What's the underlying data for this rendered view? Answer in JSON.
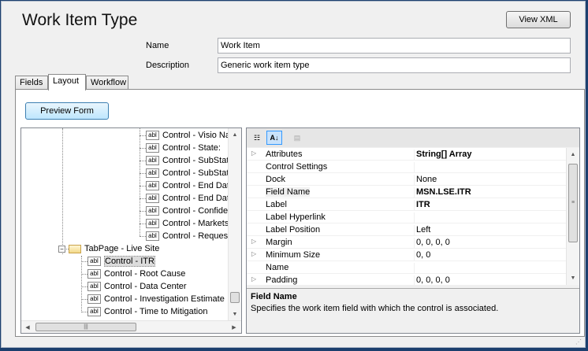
{
  "window": {
    "title": "Work Item Type",
    "view_xml": "View XML"
  },
  "form": {
    "name_label": "Name",
    "name_value": "Work Item",
    "desc_label": "Description",
    "desc_value": "Generic work item type"
  },
  "tabs": [
    {
      "label": "Fields"
    },
    {
      "label": "Layout"
    },
    {
      "label": "Workflow"
    }
  ],
  "preview_button": "Preview Form",
  "tree": {
    "items_top": [
      "Control - Visio Nar",
      "Control - State:",
      "Control - SubState",
      "Control - SubState",
      "Control - End Date",
      "Control - End Date",
      "Control - Confiden",
      "Control - Markets:",
      "Control - Requeste"
    ],
    "tabpage": "TabPage - Live Site",
    "items_bottom": [
      "Control - ITR",
      "Control - Root Cause",
      "Control - Data Center",
      "Control - Investigation Estimate",
      "Control - Time to Mitigation"
    ],
    "icon_text": "abl"
  },
  "properties": {
    "rows": [
      {
        "name": "Attributes",
        "value": "String[] Array",
        "expand": true,
        "bold": true
      },
      {
        "name": "Control Settings",
        "value": "",
        "expand": false,
        "bold": false
      },
      {
        "name": "Dock",
        "value": "None",
        "expand": false,
        "bold": false
      },
      {
        "name": "Field Name",
        "value": "MSN.LSE.ITR",
        "expand": false,
        "bold": true
      },
      {
        "name": "Label",
        "value": "ITR",
        "expand": false,
        "bold": true
      },
      {
        "name": "Label Hyperlink",
        "value": "",
        "expand": false,
        "bold": false
      },
      {
        "name": "Label Position",
        "value": "Left",
        "expand": false,
        "bold": false
      },
      {
        "name": "Margin",
        "value": "0, 0, 0, 0",
        "expand": true,
        "bold": false
      },
      {
        "name": "Minimum Size",
        "value": "0, 0",
        "expand": true,
        "bold": false
      },
      {
        "name": "Name",
        "value": "",
        "expand": false,
        "bold": false
      },
      {
        "name": "Padding",
        "value": "0, 0, 0, 0",
        "expand": true,
        "bold": false
      }
    ],
    "description_title": "Field Name",
    "description_text": "Specifies the work item field with which the control is associated."
  }
}
